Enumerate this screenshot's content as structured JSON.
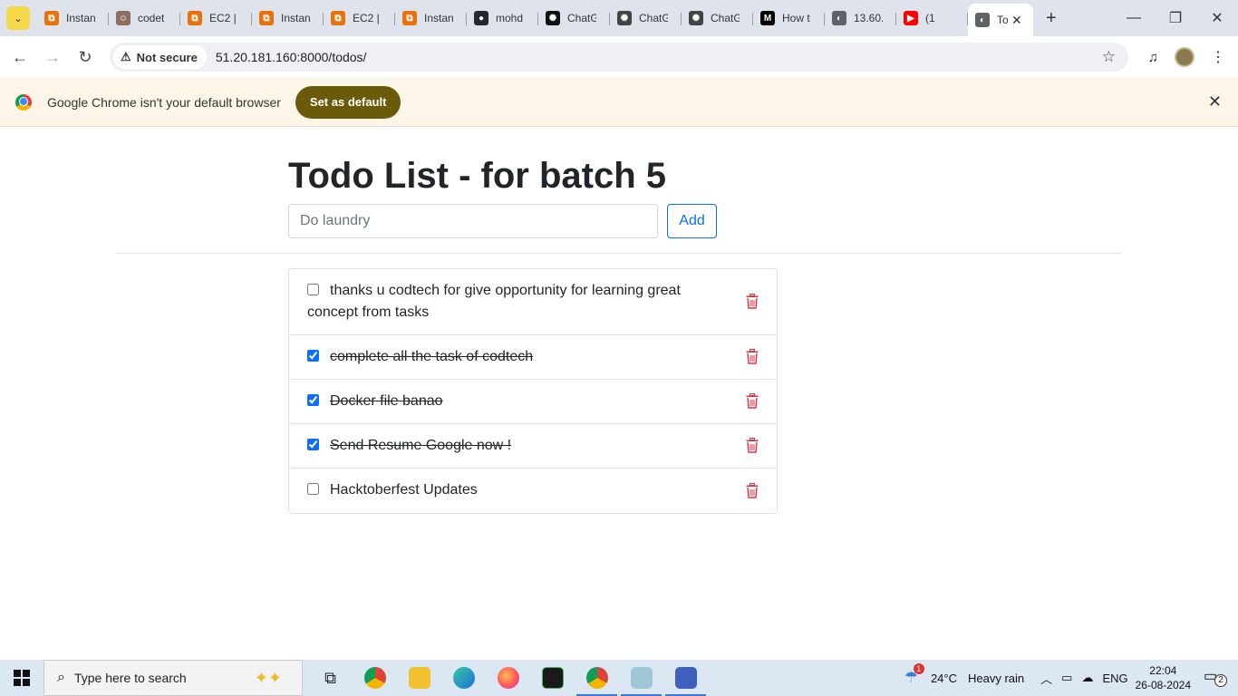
{
  "browser": {
    "tabs": [
      {
        "label": "Instan",
        "color": "#e8710a",
        "glyph": "⧉"
      },
      {
        "label": "codet",
        "color": "#8d6e63",
        "glyph": "☺"
      },
      {
        "label": "EC2 |",
        "color": "#e8710a",
        "glyph": "⧉"
      },
      {
        "label": "Instan",
        "color": "#e8710a",
        "glyph": "⧉"
      },
      {
        "label": "EC2 |",
        "color": "#e8710a",
        "glyph": "⧉"
      },
      {
        "label": "Instan",
        "color": "#e8710a",
        "glyph": "⧉"
      },
      {
        "label": "mohd",
        "color": "#24292f",
        "glyph": "●"
      },
      {
        "label": "ChatG",
        "color": "#111111",
        "glyph": "✺"
      },
      {
        "label": "ChatG",
        "color": "#444444",
        "glyph": "✺"
      },
      {
        "label": "ChatG",
        "color": "#444444",
        "glyph": "✺"
      },
      {
        "label": "How t",
        "color": "#000000",
        "glyph": "M"
      },
      {
        "label": "13.60.",
        "color": "#5f6368",
        "glyph": "◐"
      },
      {
        "label": "(1",
        "color": "#ff0000",
        "glyph": "▶"
      }
    ],
    "active_tab": {
      "label": "To"
    },
    "not_secure_label": "Not secure",
    "url": "51.20.181.160:8000/todos/",
    "infobar_text": "Google Chrome isn't your default browser",
    "set_default_label": "Set as default"
  },
  "page": {
    "title": "Todo List - for batch 5",
    "input_placeholder": "Do laundry",
    "add_label": "Add",
    "todos": [
      {
        "text": "thanks u codtech for give opportunity for learning great concept from tasks",
        "done": false
      },
      {
        "text": "complete all the task of codtech",
        "done": true
      },
      {
        "text": "Docker file banao",
        "done": true
      },
      {
        "text": "Send Resume Google now !",
        "done": true
      },
      {
        "text": "Hacktoberfest Updates",
        "done": false
      }
    ],
    "accent_color": "#0d6efd",
    "delete_color": "#dc3545"
  },
  "taskbar": {
    "search_placeholder": "Type here to search",
    "weather_temp": "24°C",
    "weather_desc": "Heavy rain",
    "weather_badge": "1",
    "language": "ENG",
    "time": "22:04",
    "date": "26-08-2024",
    "notifications_count": "2"
  }
}
